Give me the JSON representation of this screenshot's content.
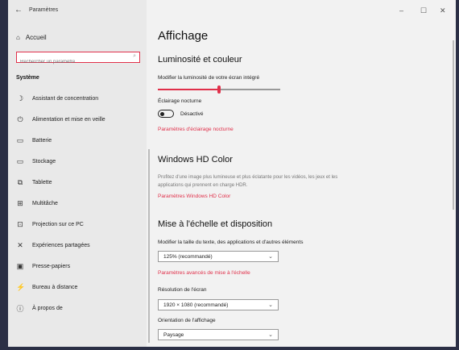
{
  "window": {
    "title": "Paramètres",
    "back_icon": "←",
    "minimize": "–",
    "maximize": "☐",
    "close": "✕"
  },
  "sidebar": {
    "home_label": "Accueil",
    "search_placeholder": "Rechercher un paramètre",
    "section_title": "Système",
    "items": [
      {
        "icon": "moon-icon",
        "glyph": "☽",
        "label": "Assistant de concentration"
      },
      {
        "icon": "power-icon",
        "glyph": "⏻",
        "label": "Alimentation et mise en veille"
      },
      {
        "icon": "battery-icon",
        "glyph": "▭",
        "label": "Batterie"
      },
      {
        "icon": "storage-icon",
        "glyph": "▭",
        "label": "Stockage"
      },
      {
        "icon": "tablet-icon",
        "glyph": "⧉",
        "label": "Tablette"
      },
      {
        "icon": "multitask-icon",
        "glyph": "⊞",
        "label": "Multitâche"
      },
      {
        "icon": "projection-icon",
        "glyph": "⊡",
        "label": "Projection sur ce PC"
      },
      {
        "icon": "shared-icon",
        "glyph": "✕",
        "label": "Expériences partagées"
      },
      {
        "icon": "clipboard-icon",
        "glyph": "▣",
        "label": "Presse-papiers"
      },
      {
        "icon": "remote-icon",
        "glyph": "⚡",
        "label": "Bureau à distance"
      },
      {
        "icon": "info-icon",
        "glyph": "ⓘ",
        "label": "À propos de"
      }
    ]
  },
  "main": {
    "title": "Affichage",
    "brightness": {
      "heading": "Luminosité et couleur",
      "slider_label": "Modifier la luminosité de votre écran intégré",
      "slider_value": 0.5
    },
    "night_light": {
      "label": "Éclairage nocturne",
      "state": "Désactivé",
      "link": "Paramètres d'éclairage nocturne"
    },
    "hd_color": {
      "heading": "Windows HD Color",
      "description": "Profitez d'une image plus lumineuse et plus éclatante pour les vidéos, les jeux et les applications qui prennent en charge HDR.",
      "link": "Paramètres Windows HD Color"
    },
    "scale": {
      "heading": "Mise à l'échelle et disposition",
      "size_label": "Modifier la taille du texte, des applications et d'autres éléments",
      "size_value": "125% (recommandé)",
      "advanced_link": "Paramètres avancés de mise à l'échelle",
      "resolution_label": "Résolution de l'écran",
      "resolution_value": "1920 × 1080 (recommandé)",
      "orientation_label": "Orientation de l'affichage",
      "orientation_value": "Paysage"
    }
  },
  "colors": {
    "accent": "#e0304a",
    "sidebar_bg": "#e9e9e9",
    "content_bg": "#f2f2f2",
    "outer_bg": "#2b2f45"
  }
}
